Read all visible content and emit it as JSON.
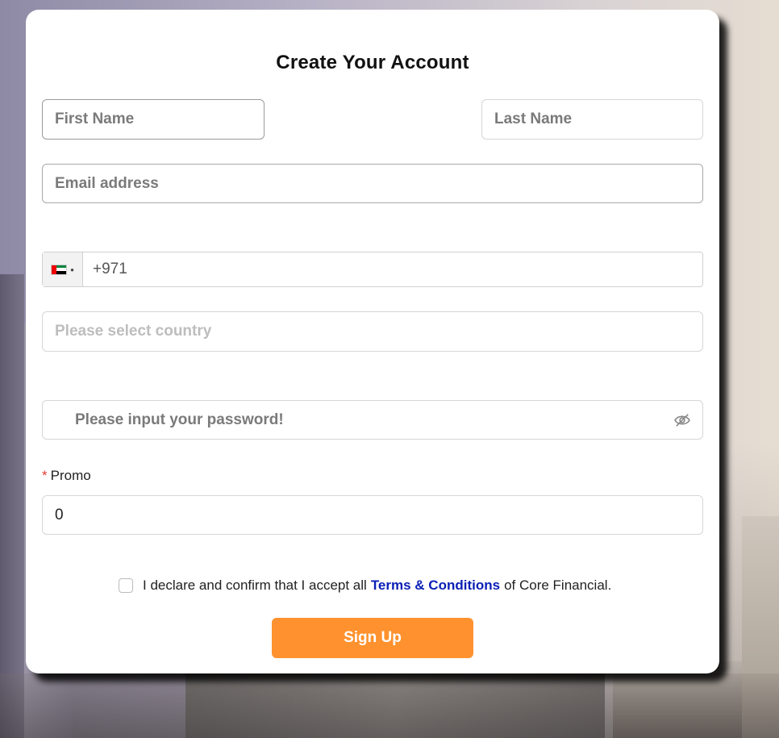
{
  "form": {
    "title": "Create Your Account",
    "first_name_placeholder": "First Name",
    "last_name_placeholder": "Last Name",
    "email_placeholder": "Email address",
    "phone": {
      "country_flag": "uae-flag-icon",
      "dial_code": "+971"
    },
    "country_placeholder": "Please select country",
    "password_placeholder": "Please input your password!",
    "password_toggle_icon": "eye-slash-icon",
    "promo_label": "Promo",
    "promo_required_mark": "*",
    "promo_value": "0",
    "terms": {
      "prefix": "I declare and confirm that I accept all",
      "link_text": "Terms & Conditions",
      "suffix": "of Core Financial.",
      "checked": false
    },
    "submit_label": "Sign Up"
  },
  "colors": {
    "accent": "#ff922e",
    "link": "#0a1fb5",
    "required": "#e53935"
  }
}
